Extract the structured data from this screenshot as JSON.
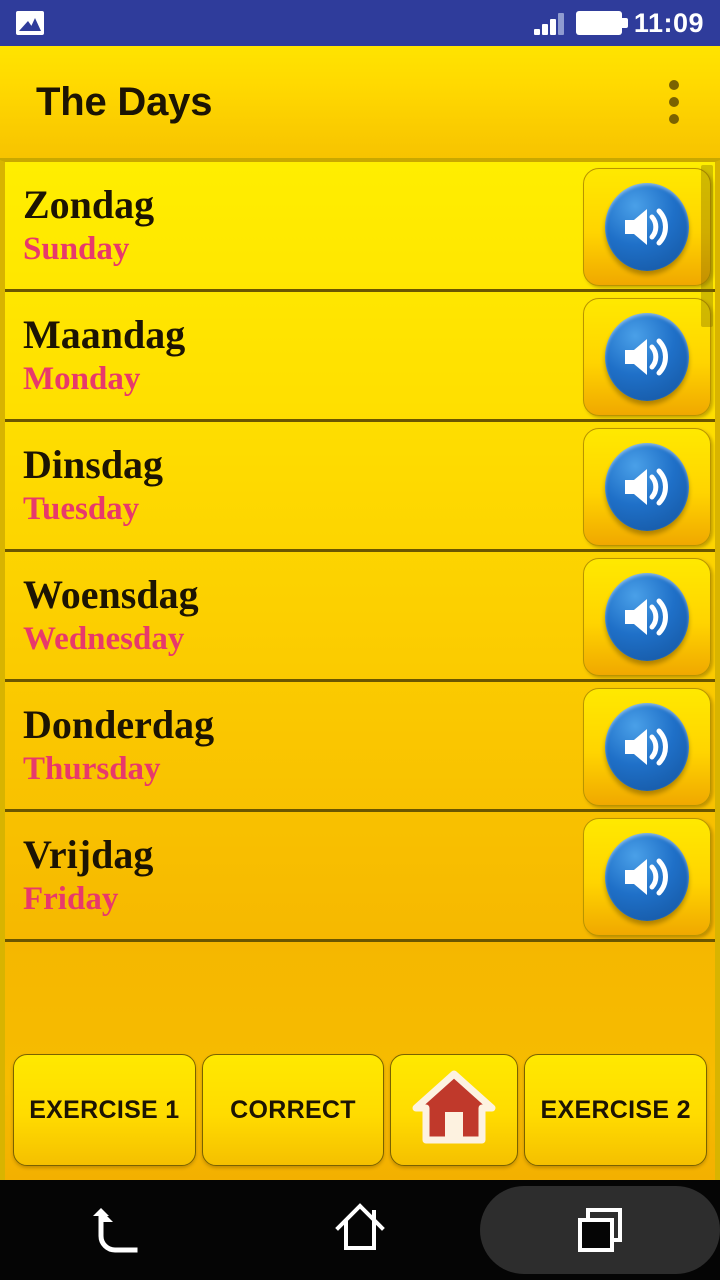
{
  "status_bar": {
    "time": "11:09",
    "icons": {
      "notification": "photo-icon",
      "signal": "signal-bars-icon",
      "battery": "battery-full-icon"
    }
  },
  "title_bar": {
    "title": "The Days",
    "overflow_menu": "overflow-menu-icon"
  },
  "list": {
    "rows": [
      {
        "native": "Zondag",
        "translation": "Sunday",
        "speak": "speaker-icon"
      },
      {
        "native": "Maandag",
        "translation": "Monday",
        "speak": "speaker-icon"
      },
      {
        "native": "Dinsdag",
        "translation": "Tuesday",
        "speak": "speaker-icon"
      },
      {
        "native": "Woensdag",
        "translation": "Wednesday",
        "speak": "speaker-icon"
      },
      {
        "native": "Donderdag",
        "translation": "Thursday",
        "speak": "speaker-icon"
      },
      {
        "native": "Vrijdag",
        "translation": "Friday",
        "speak": "speaker-icon"
      }
    ]
  },
  "bottom_bar": {
    "exercise1_label": "EXERCISE 1",
    "correct_label": "CORRECT",
    "home_icon": "house-icon",
    "exercise2_label": "EXERCISE 2"
  },
  "nav_bar": {
    "back": "back-arrow-icon",
    "home": "home-outline-icon",
    "recents": "recents-squares-icon"
  },
  "colors": {
    "status_bar_bg": "#2f3c9b",
    "title_bar_yellow": "#ffd900",
    "list_yellow_top": "#ffee00",
    "list_amber_bottom": "#f6b800",
    "native_text": "#1c1403",
    "translation_pink": "#e8396b",
    "speaker_blue": "#1f70c8",
    "house_red": "#c0392b",
    "nav_bar_bg": "#050505"
  }
}
